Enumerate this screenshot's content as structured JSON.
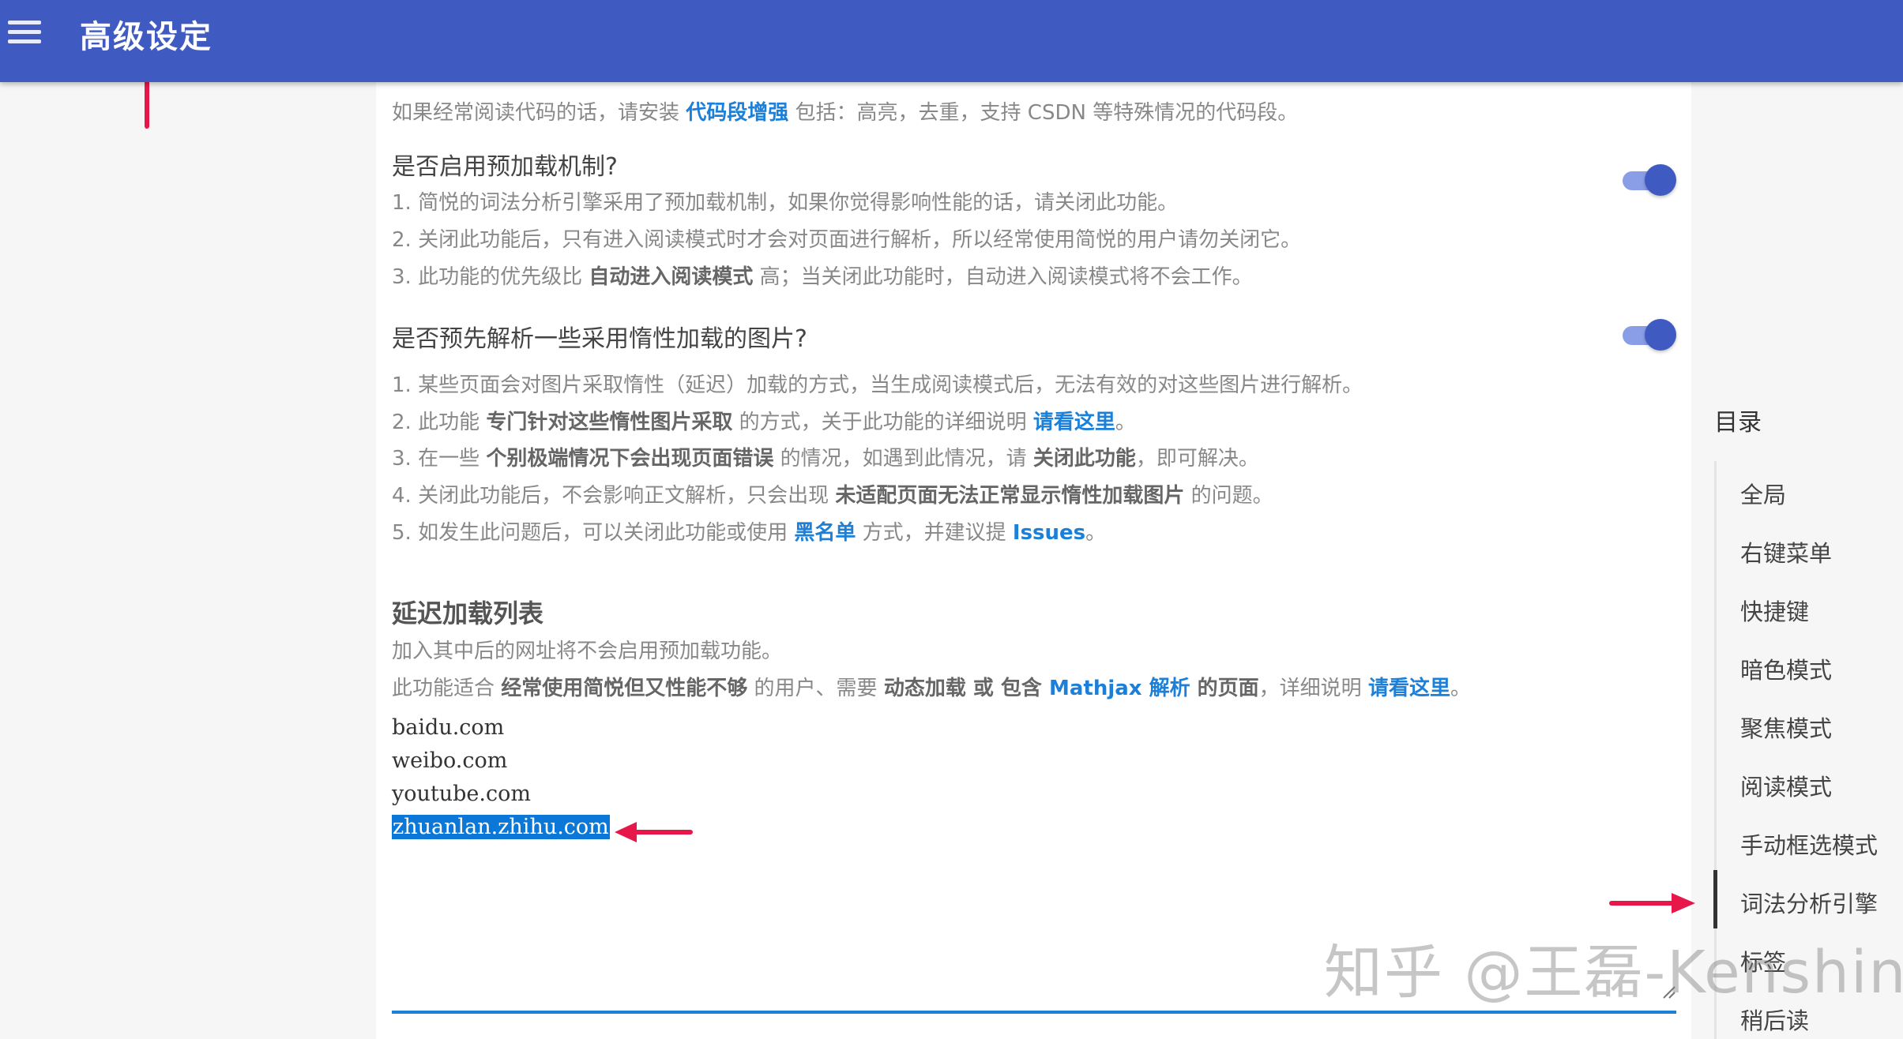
{
  "header": {
    "title": "高级设定",
    "menu_icon": "hamburger-menu-icon"
  },
  "top_line": {
    "pre": "如果经常阅读代码的话，请安装 ",
    "link": "代码段增强",
    "post": " 包括：高亮，去重，支持 CSDN 等特殊情况的代码段。"
  },
  "preload": {
    "title": "是否启用预加载机制?",
    "enabled": true,
    "line1": "1. 简悦的词法分析引擎采用了预加载机制，如果你觉得影响性能的话，请关闭此功能。",
    "line2": "2. 关闭此功能后，只有进入阅读模式时才会对页面进行解析，所以经常使用简悦的用户请勿关闭它。",
    "line3_pre": "3. 此功能的优先级比 ",
    "line3_bold": "自动进入阅读模式",
    "line3_post": " 高；当关闭此功能时，自动进入阅读模式将不会工作。"
  },
  "lazyload": {
    "title": "是否预先解析一些采用惰性加载的图片?",
    "enabled": true,
    "line1": "1. 某些页面会对图片采取惰性（延迟）加载的方式，当生成阅读模式后，无法有效的对这些图片进行解析。",
    "line2_pre": "2. 此功能 ",
    "line2_bold": "专门针对这些惰性图片采取",
    "line2_mid": " 的方式，关于此功能的详细说明 ",
    "line2_link": "请看这里",
    "line2_post": "。",
    "line3_pre": "3. 在一些 ",
    "line3_bold": "个别极端情况下会出现页面错误",
    "line3_mid": " 的情况，如遇到此情况，请 ",
    "line3_bold2": "关闭此功能",
    "line3_post": "，即可解决。",
    "line4_pre": "4. 关闭此功能后，不会影响正文解析，只会出现 ",
    "line4_bold": "未适配页面无法正常显示惰性加载图片",
    "line4_post": " 的问题。",
    "line5_pre": "5. 如发生此问题后，可以关闭此功能或使用 ",
    "line5_link": "黑名单",
    "line5_mid": " 方式，并建议提 ",
    "line5_link2": "Issues",
    "line5_post": "。"
  },
  "delay_list": {
    "title": "延迟加载列表",
    "desc1": "加入其中后的网址将不会启用预加载功能。",
    "desc2_pre": "此功能适合 ",
    "desc2_bold1": "经常使用简悦但又性能不够",
    "desc2_mid1": " 的用户、需要 ",
    "desc2_bold2": "动态加载 或 包含 ",
    "desc2_link1": "Mathjax 解析",
    "desc2_bold3": " 的页面",
    "desc2_mid2": "，详细说明 ",
    "desc2_link2": "请看这里",
    "desc2_post": "。",
    "urls": [
      "baidu.com",
      "weibo.com",
      "youtube.com",
      "zhuanlan.zhihu.com"
    ],
    "selected_url_index": 3
  },
  "toc": {
    "title": "目录",
    "items": [
      "全局",
      "右键菜单",
      "快捷键",
      "暗色模式",
      "聚焦模式",
      "阅读模式",
      "手动框选模式",
      "词法分析引擎",
      "标签",
      "稍后读"
    ],
    "active_index": 7
  },
  "watermark": "知乎 @王磊-Kenshin",
  "colors": {
    "header": "#3f5bc1",
    "link": "#1c7fd8",
    "toggle_on": "#3f5bc1",
    "annotation_arrow": "#e8174a",
    "selection": "#0b78d8"
  }
}
